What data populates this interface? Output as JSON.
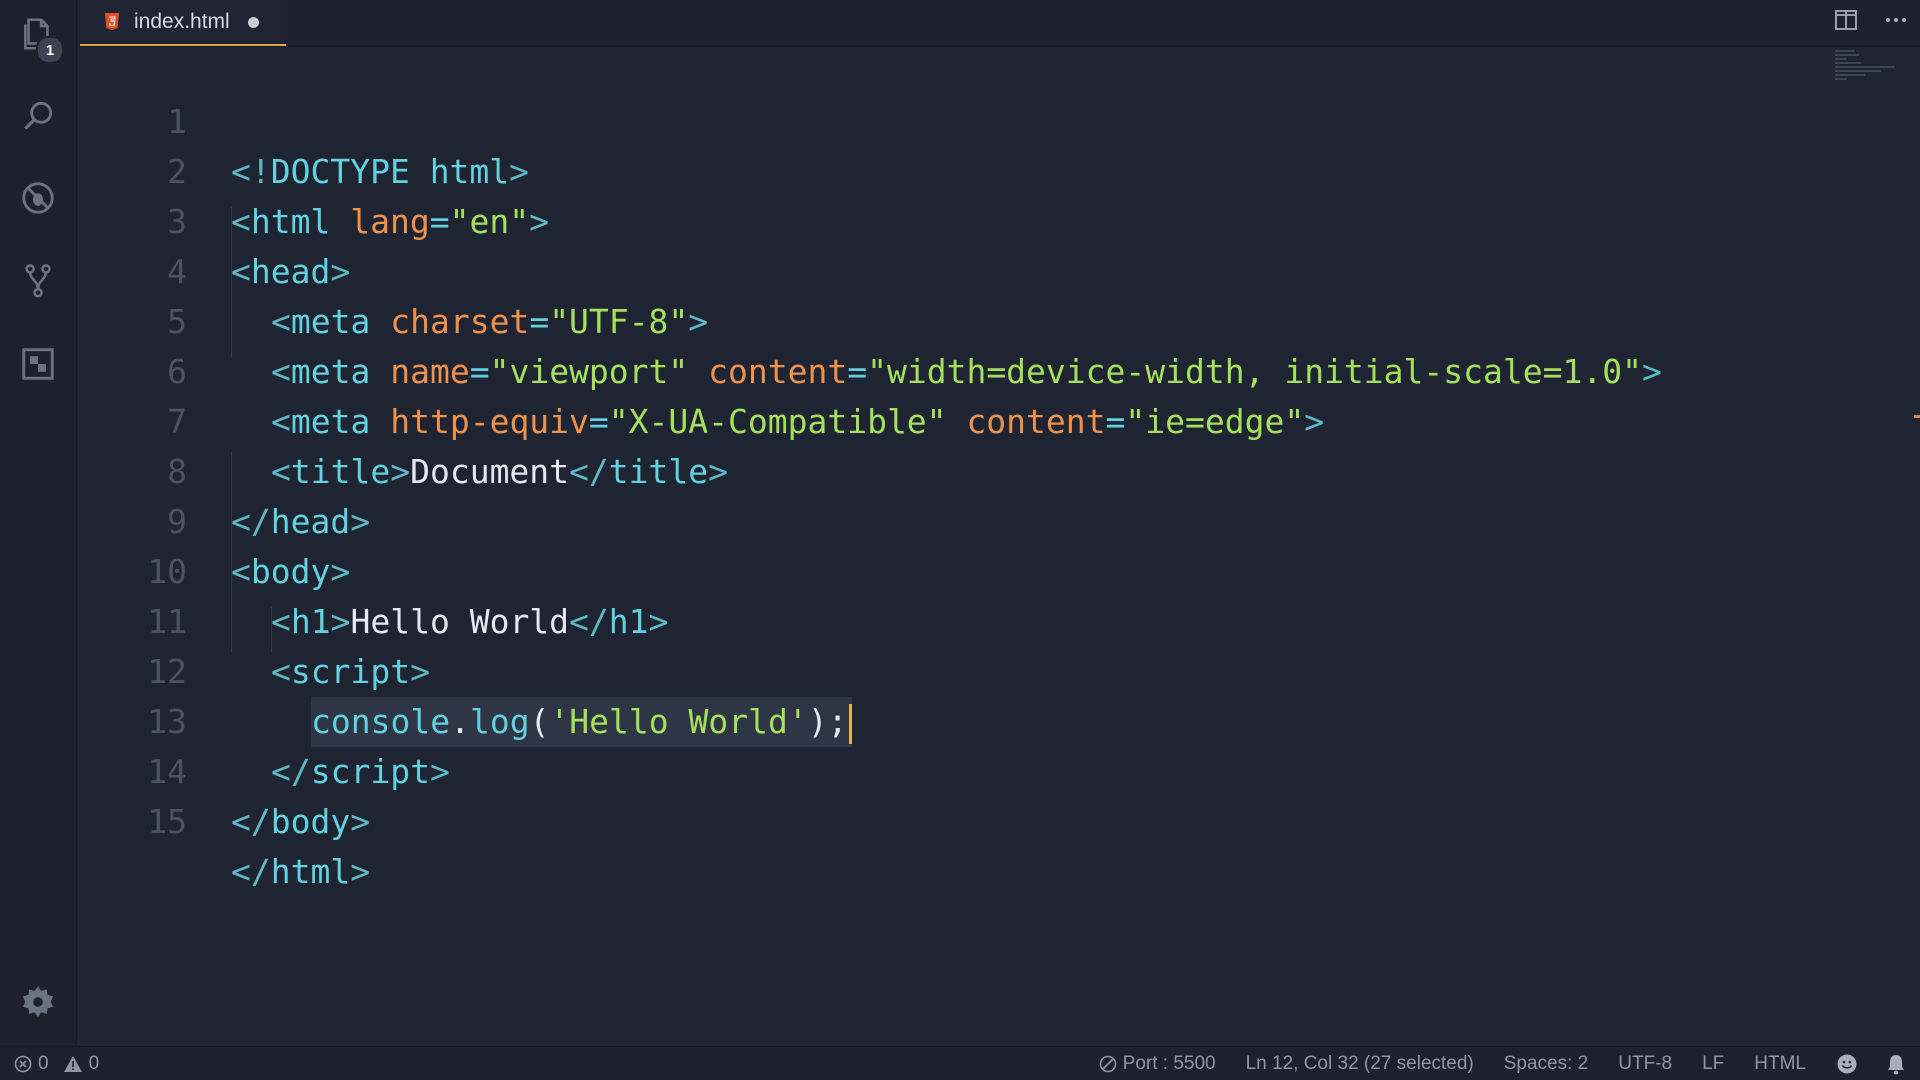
{
  "activity_bar": {
    "explorer_badge": "1",
    "icons": [
      "files-icon",
      "search-icon",
      "debug-icon",
      "source-control-icon",
      "extensions-icon",
      "gear-icon"
    ]
  },
  "tab": {
    "filename": "index.html",
    "modified": true
  },
  "editor": {
    "line_numbers": [
      "1",
      "2",
      "3",
      "4",
      "5",
      "6",
      "7",
      "8",
      "9",
      "10",
      "11",
      "12",
      "13",
      "14",
      "15"
    ],
    "lines": {
      "l1": [
        "<!",
        "DOCTYPE html",
        ">"
      ],
      "l2": [
        "<",
        "html",
        " ",
        "lang",
        "=",
        "\"en\"",
        ">"
      ],
      "l3": [
        "<",
        "head",
        ">"
      ],
      "l4": [
        "<",
        "meta",
        " ",
        "charset",
        "=",
        "\"UTF-8\"",
        ">"
      ],
      "l5": [
        "<",
        "meta",
        " ",
        "name",
        "=",
        "\"viewport\"",
        " ",
        "content",
        "=",
        "\"width=device-width, initial-scale=1.0\"",
        ">"
      ],
      "l6": [
        "<",
        "meta",
        " ",
        "http-equiv",
        "=",
        "\"X-UA-Compatible\"",
        " ",
        "content",
        "=",
        "\"ie=edge\"",
        ">"
      ],
      "l7": [
        "<",
        "title",
        ">",
        "Document",
        "</",
        "title",
        ">"
      ],
      "l8": [
        "</",
        "head",
        ">"
      ],
      "l9": [
        "<",
        "body",
        ">"
      ],
      "l10": [
        "<",
        "h1",
        ">",
        "Hello World",
        "</",
        "h1",
        ">"
      ],
      "l11": [
        "<",
        "script",
        ">"
      ],
      "l12": [
        "console",
        ".",
        "log",
        "(",
        "'Hello World'",
        ")",
        ";"
      ],
      "l13": [
        "</",
        "script",
        ">"
      ],
      "l14": [
        "</",
        "body",
        ">"
      ],
      "l15": [
        "</",
        "html",
        ">"
      ]
    }
  },
  "statusbar": {
    "errors": "0",
    "warnings": "0",
    "port": "Port : 5500",
    "position": "Ln 12, Col 32 (27 selected)",
    "spaces": "Spaces: 2",
    "encoding": "UTF-8",
    "eol": "LF",
    "language": "HTML"
  },
  "colors": {
    "background": "#1e2431",
    "tag": "#62d0de",
    "attribute": "#f0914a",
    "string": "#a5e05c",
    "cursor": "#e8b04a"
  }
}
